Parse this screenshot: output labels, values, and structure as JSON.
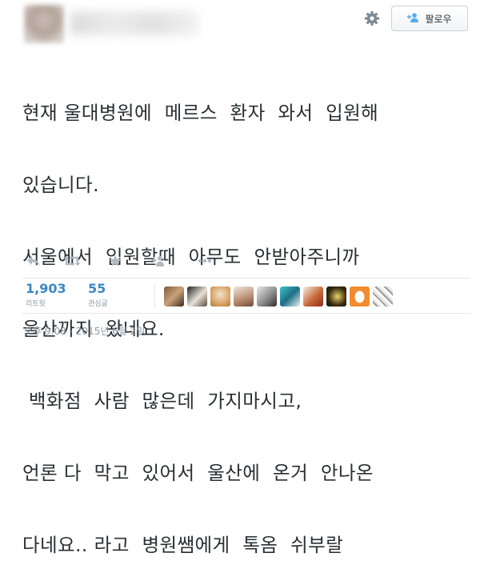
{
  "header": {
    "follow_label": "팔로우"
  },
  "tweet": {
    "lines": [
      "현재 울대병원에  메르스  환자  와서  입원해",
      "있습니다.",
      "서울에서  입원할때  아무도  안받아주니까",
      "울산까지  왔네요.",
      " 백화점  사람  많은데  가지마시고,",
      "언론 다  막고  있어서  울산에  온거  안나온",
      "다네요.. 라고  병원쌤에게  톡옴  쉬부랄"
    ]
  },
  "actions": {
    "icons": [
      "reply-icon",
      "retweet-icon",
      "favorite-icon",
      "follow-icon",
      "more-icon"
    ]
  },
  "stats": {
    "retweets": {
      "value": "1,903",
      "label": "리트윗"
    },
    "favorites": {
      "value": "55",
      "label": "관심글"
    }
  },
  "timestamp": "오후 9:08 - 2015년 6월 2일",
  "colors": {
    "link_blue": "#3b88c3",
    "muted_gray": "#8899a6",
    "text": "#292f33",
    "icon_gray": "#b0bac2"
  }
}
